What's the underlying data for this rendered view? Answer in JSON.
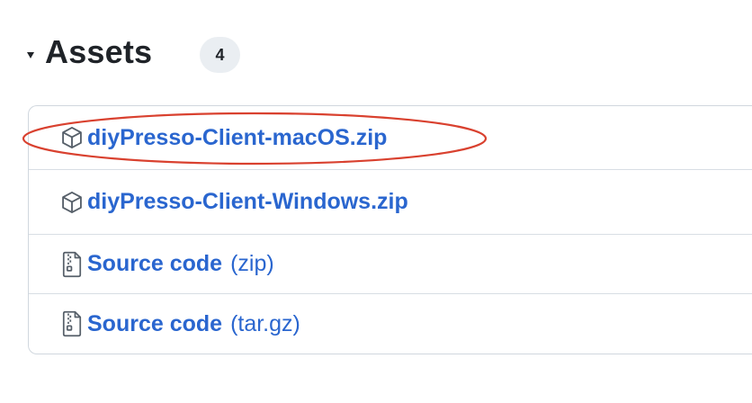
{
  "section": {
    "title": "Assets",
    "count": "4"
  },
  "assets": [
    {
      "name": "diyPresso-Client-macOS.zip",
      "icon": "package-icon"
    },
    {
      "name": "diyPresso-Client-Windows.zip",
      "icon": "package-icon"
    },
    {
      "name": "Source code",
      "ext": "(zip)",
      "icon": "file-zip-icon"
    },
    {
      "name": "Source code",
      "ext": "(tar.gz)",
      "icon": "file-zip-icon"
    }
  ],
  "colors": {
    "link": "#2a66cf",
    "text": "#1f2328",
    "border": "#d0d7de",
    "badge_bg": "#eaeef2",
    "highlight": "#d9412f"
  }
}
